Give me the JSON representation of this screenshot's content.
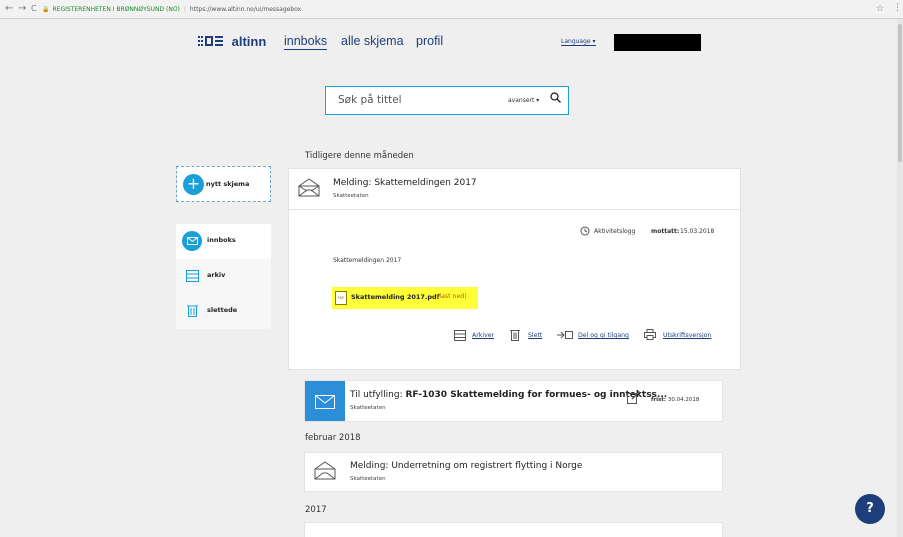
{
  "browser": {
    "back": "←",
    "forward": "→",
    "reload": "C",
    "secure_label": "REGISTERENHETEN I BRØNNØYSUND (NO)",
    "url": "https://www.altinn.no/ui/messagebox",
    "star": "☆",
    "menu": "⋮"
  },
  "header": {
    "logo_text": "altinn",
    "nav": [
      "innboks",
      "alle skjema",
      "profil"
    ],
    "language": "Language ▾"
  },
  "search": {
    "placeholder": "Søk på tittel",
    "advanced": "avansert ▾"
  },
  "sidebar": {
    "new_form": "nytt skjema",
    "items": [
      "innboks",
      "arkiv",
      "slettede"
    ]
  },
  "sections": {
    "earlier_this_month": "Tidligere denne måneden",
    "feb_2018": "februar 2018",
    "y2017": "2017"
  },
  "expanded_message": {
    "title": "Melding: Skattemeldingen 2017",
    "sender": "Skatteetaten",
    "activity_log": "Aktivitetslogg",
    "received_label": "mottatt:",
    "received_date": "15.03.2018",
    "body": "Skattemeldingen 2017",
    "attachment_name": "Skattemelding 2017.pdf",
    "attachment_action": "(last ned)",
    "attachment_icon_text": "PDF",
    "actions": [
      "Arkiver",
      "Slett",
      "Del og gi tilgang",
      "Utskriftsversjon"
    ]
  },
  "message2": {
    "prefix": "Til utfylling:",
    "title": "RF-1030 Skattemelding for formues- og inntektss...",
    "sender": "Skatteetaten",
    "deadline_label": "frist:",
    "deadline_date": "30.04.2018"
  },
  "message3": {
    "title": "Melding: Underretning om registrert flytting i Norge",
    "sender": "Skatteetaten"
  },
  "help": "?"
}
